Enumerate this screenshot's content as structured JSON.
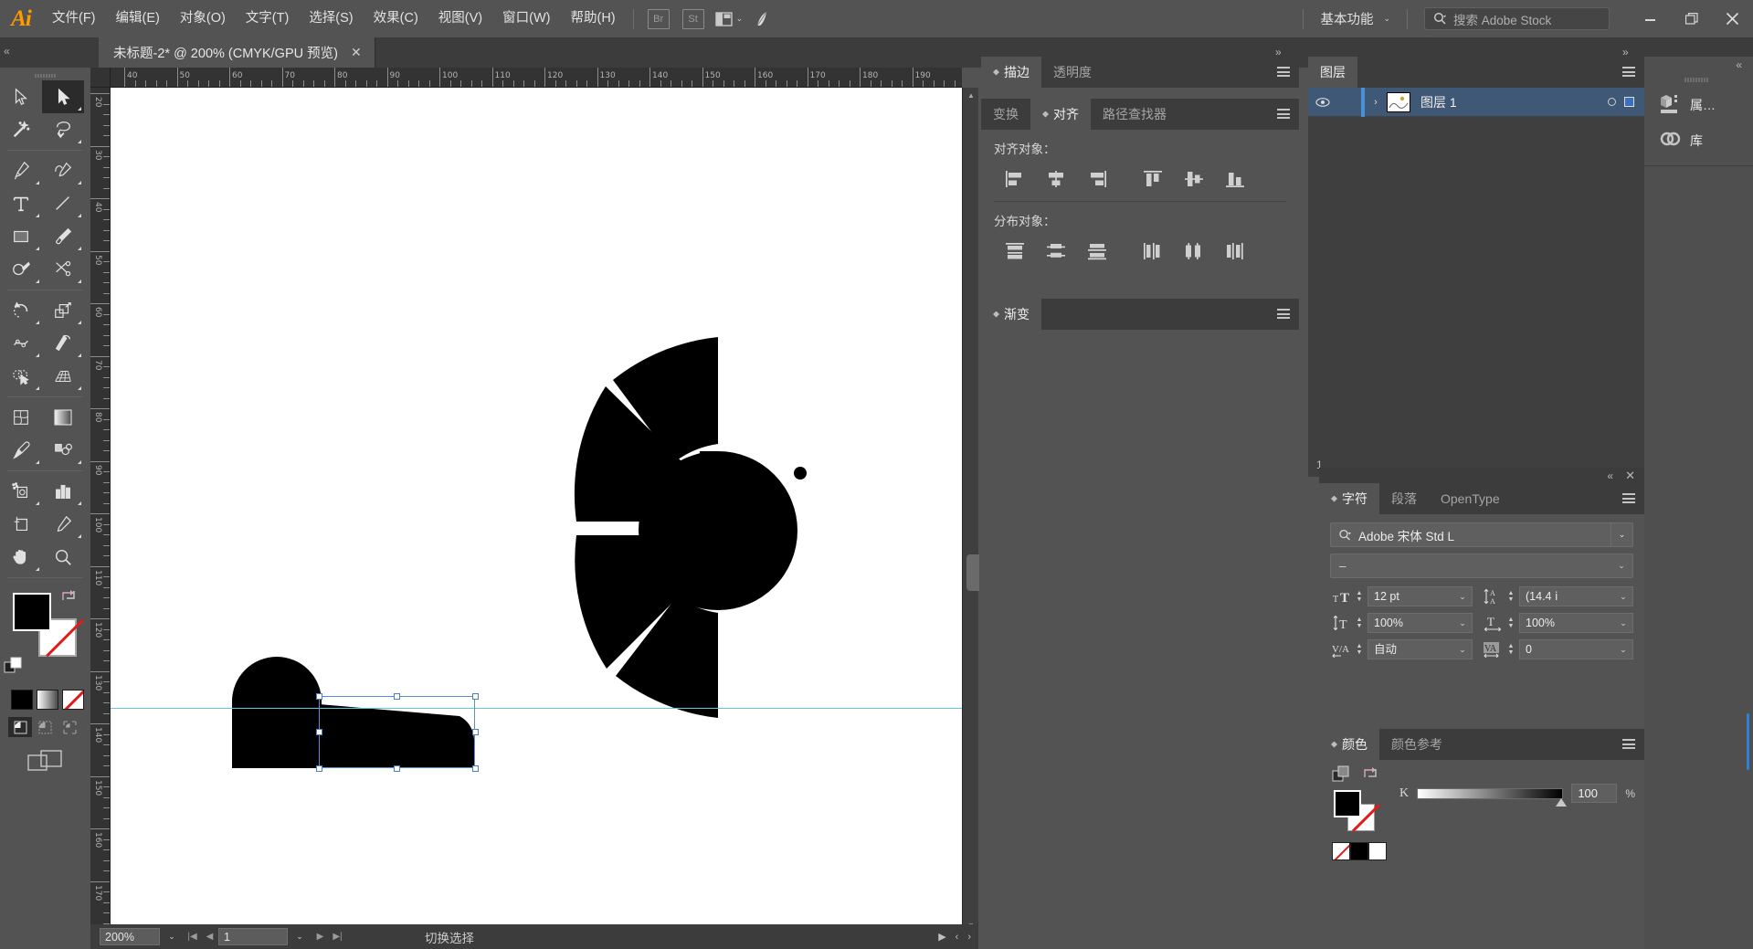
{
  "app": {
    "logo": "Ai"
  },
  "menubar": {
    "items": [
      "文件(F)",
      "编辑(E)",
      "对象(O)",
      "文字(T)",
      "选择(S)",
      "效果(C)",
      "视图(V)",
      "窗口(W)",
      "帮助(H)"
    ],
    "bridge_label": "Br",
    "stock_label": "St",
    "arrange_icon": "arrange-icon",
    "chevron": "⌄",
    "workspace": "基本功能",
    "search_placeholder": "搜索 Adobe Stock",
    "search_icon": "search-icon",
    "minimize": "–",
    "restore": "❐",
    "close": "✕"
  },
  "document": {
    "tab_title": "未标题-2* @ 200% (CMYK/GPU 预览)",
    "tab_close": "✕"
  },
  "toolbar": {
    "tools": [
      {
        "name": "selection-tool",
        "active": false
      },
      {
        "name": "direct-selection-tool",
        "active": true
      },
      {
        "name": "magic-wand-tool",
        "active": false
      },
      {
        "name": "lasso-tool",
        "active": false
      },
      {
        "name": "pen-tool",
        "active": false
      },
      {
        "name": "curvature-tool",
        "active": false
      },
      {
        "name": "type-tool",
        "active": false
      },
      {
        "name": "line-segment-tool",
        "active": false
      },
      {
        "name": "rectangle-tool",
        "active": false
      },
      {
        "name": "paintbrush-tool",
        "active": false
      },
      {
        "name": "shaper-tool",
        "active": false
      },
      {
        "name": "scissors-tool",
        "active": false
      },
      {
        "name": "rotate-tool",
        "active": false
      },
      {
        "name": "scale-tool",
        "active": false
      },
      {
        "name": "width-tool",
        "active": false
      },
      {
        "name": "free-transform-tool",
        "active": false
      },
      {
        "name": "shape-builder-tool",
        "active": false
      },
      {
        "name": "perspective-grid-tool",
        "active": false
      },
      {
        "name": "mesh-tool",
        "active": false
      },
      {
        "name": "gradient-tool",
        "active": false
      },
      {
        "name": "eyedropper-tool",
        "active": false
      },
      {
        "name": "blend-tool",
        "active": false
      },
      {
        "name": "symbol-sprayer-tool",
        "active": false
      },
      {
        "name": "column-graph-tool",
        "active": false
      },
      {
        "name": "artboard-tool",
        "active": false
      },
      {
        "name": "slice-tool",
        "active": false
      },
      {
        "name": "hand-tool",
        "active": false
      },
      {
        "name": "zoom-tool",
        "active": false
      }
    ],
    "fill_color": "#000000",
    "stroke_color": "#ffffff",
    "stroke_none": true,
    "draw_modes": [
      "draw-normal",
      "draw-behind",
      "draw-inside"
    ],
    "draw_active_index": 0
  },
  "rulers": {
    "h_labels": [
      "40",
      "50",
      "60",
      "70",
      "80",
      "90",
      "100",
      "110",
      "120",
      "130",
      "140",
      "150",
      "160",
      "170",
      "180",
      "190"
    ],
    "v_labels": [
      "20",
      "30",
      "40",
      "50",
      "60",
      "70",
      "80",
      "90",
      "100",
      "110",
      "120",
      "130",
      "140",
      "150",
      "160",
      "170"
    ],
    "unit": "mm"
  },
  "statusbar": {
    "zoom": "200%",
    "page": "1",
    "status_text": "切换选择",
    "first_icon": "◀│",
    "prev_icon": "◀",
    "next_icon": "▶",
    "last_icon": "│▶"
  },
  "panels": {
    "stroke_transparency": {
      "tabs": [
        {
          "label": "描边",
          "active": true
        },
        {
          "label": "透明度",
          "active": false
        }
      ]
    },
    "align": {
      "tabs": [
        {
          "label": "变换",
          "active": false
        },
        {
          "label": "对齐",
          "active": true
        },
        {
          "label": "路径查找器",
          "active": false
        }
      ],
      "align_objects_label": "对齐对象：",
      "distribute_objects_label": "分布对象：",
      "align_buttons": [
        "align-left-icon",
        "align-horizontal-center-icon",
        "align-right-icon",
        "align-top-icon",
        "align-vertical-center-icon",
        "align-bottom-icon"
      ],
      "distribute_buttons": [
        "distribute-top-icon",
        "distribute-vertical-center-icon",
        "distribute-bottom-icon",
        "distribute-left-icon",
        "distribute-horizontal-center-icon",
        "distribute-right-icon"
      ]
    },
    "gradient": {
      "tabs": [
        {
          "label": "渐变",
          "active": true
        }
      ]
    },
    "layers": {
      "tabs": [
        {
          "label": "图层",
          "active": true
        }
      ],
      "rows": [
        {
          "name": "图层 1",
          "visible": true,
          "selected": true,
          "expand": "›"
        }
      ],
      "count": "1"
    },
    "character": {
      "tabs": [
        {
          "label": "字符",
          "active": true
        },
        {
          "label": "段落",
          "active": false
        },
        {
          "label": "OpenType",
          "active": false
        }
      ],
      "font_family": "Adobe 宋体 Std L",
      "font_style": "–",
      "fields": [
        {
          "icon": "font-size-icon",
          "label": "font-size",
          "value": "12 pt"
        },
        {
          "icon": "leading-icon",
          "label": "leading",
          "value": "(14.4 ⅰ"
        },
        {
          "icon": "vertical-scale-icon",
          "label": "vertical-scale",
          "value": "100%"
        },
        {
          "icon": "horizontal-scale-icon",
          "label": "horizontal-scale",
          "value": "100%"
        },
        {
          "icon": "kerning-icon",
          "label": "kerning",
          "value": "自动"
        },
        {
          "icon": "tracking-icon",
          "label": "tracking",
          "value": "0"
        }
      ],
      "collapse": "«",
      "close": "✕"
    },
    "color": {
      "tabs": [
        {
          "label": "颜色",
          "active": true
        },
        {
          "label": "颜色参考",
          "active": false
        }
      ],
      "channel_label": "K",
      "channel_value": "100",
      "channel_unit": "%",
      "fill_color": "#000000"
    },
    "right_dock": [
      {
        "label": "属…",
        "icon": "properties-icon"
      },
      {
        "label": "库",
        "icon": "libraries-icon"
      }
    ],
    "collapse_icons": {
      "double_left": "«",
      "double_right": "»"
    }
  },
  "artwork": {
    "description": "black radial helmet-like shape and selected rounded path",
    "fill": "#000000",
    "guide_color": "#5fc8e0",
    "selection_color": "#5a8fd6"
  }
}
